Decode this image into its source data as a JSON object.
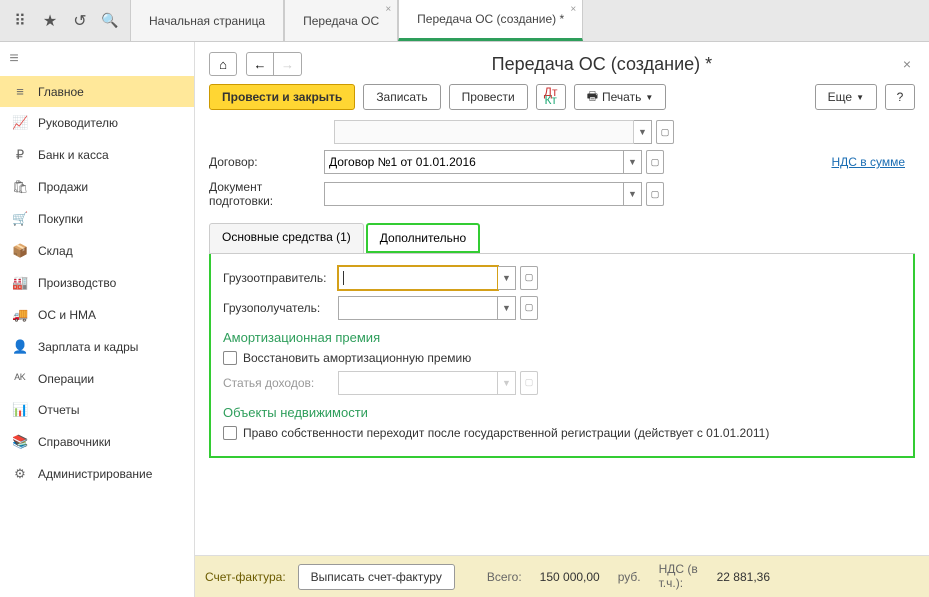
{
  "topbar": {
    "tabs": [
      {
        "label": "Начальная страница",
        "closable": false
      },
      {
        "label": "Передача ОС",
        "closable": true
      },
      {
        "label": "Передача ОС (создание) *",
        "closable": true,
        "active": true
      }
    ]
  },
  "sidebar": {
    "items": [
      {
        "icon": "≡",
        "label": "Главное",
        "active": true
      },
      {
        "icon": "📈",
        "label": "Руководителю"
      },
      {
        "icon": "₽",
        "label": "Банк и касса"
      },
      {
        "icon": "🛍",
        "label": "Продажи"
      },
      {
        "icon": "🛒",
        "label": "Покупки"
      },
      {
        "icon": "📦",
        "label": "Склад"
      },
      {
        "icon": "🏭",
        "label": "Производство"
      },
      {
        "icon": "🚚",
        "label": "ОС и НМА"
      },
      {
        "icon": "👤",
        "label": "Зарплата и кадры"
      },
      {
        "icon": "ᴬᴷ",
        "label": "Операции"
      },
      {
        "icon": "📊",
        "label": "Отчеты"
      },
      {
        "icon": "📚",
        "label": "Справочники"
      },
      {
        "icon": "⚙",
        "label": "Администрирование"
      }
    ]
  },
  "page": {
    "title": "Передача ОС (создание) *",
    "toolbar": {
      "submit": "Провести и закрыть",
      "save": "Записать",
      "post": "Провести",
      "print": "Печать",
      "more": "Еще",
      "help": "?"
    },
    "fields": {
      "contract_label": "Договор:",
      "contract_value": "Договор №1 от 01.01.2016",
      "prepdoc_label": "Документ подготовки:",
      "nds_link": "НДС в сумме"
    },
    "doc_tabs": {
      "main": "Основные средства (1)",
      "extra": "Дополнительно"
    },
    "extra": {
      "sender_label": "Грузоотправитель:",
      "receiver_label": "Грузополучатель:",
      "amort_title": "Амортизационная премия",
      "amort_check": "Восстановить амортизационную премию",
      "income_label": "Статья доходов:",
      "realty_title": "Объекты недвижимости",
      "realty_check": "Право собственности переходит после государственной регистрации (действует с 01.01.2011)"
    },
    "footer": {
      "invoice_label": "Счет-фактура:",
      "invoice_btn": "Выписать счет-фактуру",
      "total_label": "Всего:",
      "total_value": "150 000,00",
      "currency": "руб.",
      "nds_label": "НДС (в т.ч.):",
      "nds_value": "22 881,36"
    }
  }
}
